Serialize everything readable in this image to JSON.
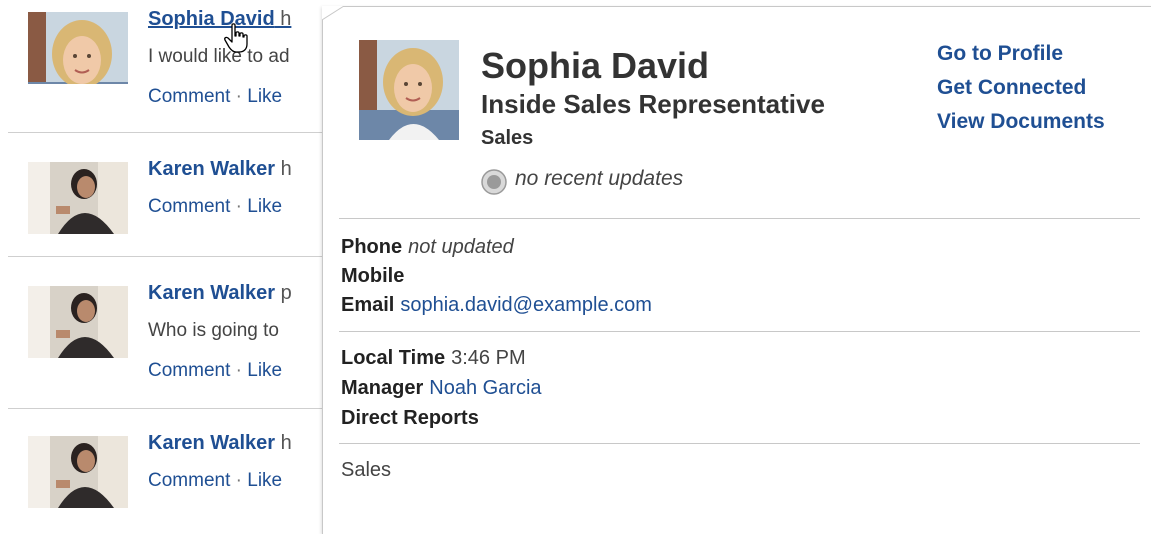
{
  "feed": {
    "items": [
      {
        "author": "Sophia David",
        "rest": " h",
        "text": "I would like to ad",
        "actions": [
          "Comment",
          "Like"
        ]
      },
      {
        "author": "Karen Walker",
        "rest": " h",
        "text": "",
        "actions": [
          "Comment",
          "Like"
        ]
      },
      {
        "author": "Karen Walker",
        "rest": " p",
        "text": "Who is going to",
        "actions": [
          "Comment",
          "Like"
        ]
      },
      {
        "author": "Karen Walker",
        "rest": " h",
        "text": "",
        "actions": [
          "Comment",
          "Like"
        ]
      }
    ],
    "action_separator": " · "
  },
  "card": {
    "name": "Sophia David",
    "title": "Inside Sales Representative",
    "department": "Sales",
    "status": "no recent updates",
    "links": [
      "Go to Profile",
      "Get Connected",
      "View Documents"
    ],
    "contact": {
      "phone_label": "Phone",
      "phone_value": "not updated",
      "mobile_label": "Mobile",
      "mobile_value": "",
      "email_label": "Email",
      "email_value": "sophia.david@example.com"
    },
    "org": {
      "local_time_label": "Local Time",
      "local_time_value": "3:46 PM",
      "manager_label": "Manager",
      "manager_value": "Noah Garcia",
      "direct_reports_label": "Direct Reports",
      "direct_reports_value": ""
    },
    "about": "Sales"
  },
  "colors": {
    "link": "#1f4f93",
    "divider": "#c8c8c8"
  },
  "icons": {
    "status": "status-circle-icon",
    "cursor": "hand-pointer-icon"
  }
}
